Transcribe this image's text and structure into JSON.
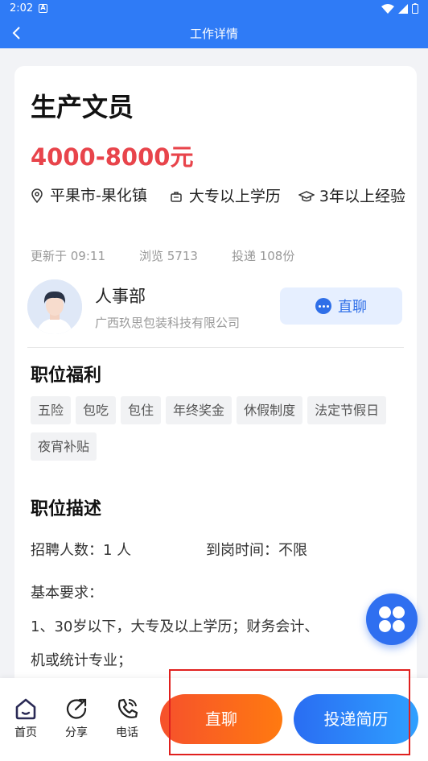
{
  "status": {
    "time": "2:02"
  },
  "nav": {
    "title": "工作详情"
  },
  "job": {
    "title": "生产文员",
    "salary": "4000-8000元",
    "location": "平果市-果化镇",
    "education": "大专以上学历",
    "experience": "3年以上经验"
  },
  "stats": {
    "updated": "更新于 09:11",
    "views": "浏览 5713",
    "applies": "投递 108份"
  },
  "hr": {
    "name": "人事部",
    "company": "广西玖思包装科技有限公司",
    "chat_label": "直聊"
  },
  "benefits": {
    "title": "职位福利",
    "tags": [
      "五险",
      "包吃",
      "包住",
      "年终奖金",
      "休假制度",
      "法定节假日",
      "夜宵补贴"
    ]
  },
  "description": {
    "title": "职位描述",
    "headcount": "招聘人数：1 人",
    "arrival": "到岗时间：不限",
    "requirements_label": "基本要求：",
    "line1": "1、30岁以下，大专及以上学历；财务会计、",
    "line2": "机或统计专业；"
  },
  "bottom": {
    "home": "首页",
    "share": "分享",
    "phone": "电话",
    "chat": "直聊",
    "apply": "投递简历"
  },
  "colors": {
    "primary": "#2f7bf6",
    "salary": "#e8444b",
    "chat_button": "#ff6a1a",
    "apply_button": "#2f85f8",
    "highlight": "#e0201e"
  }
}
